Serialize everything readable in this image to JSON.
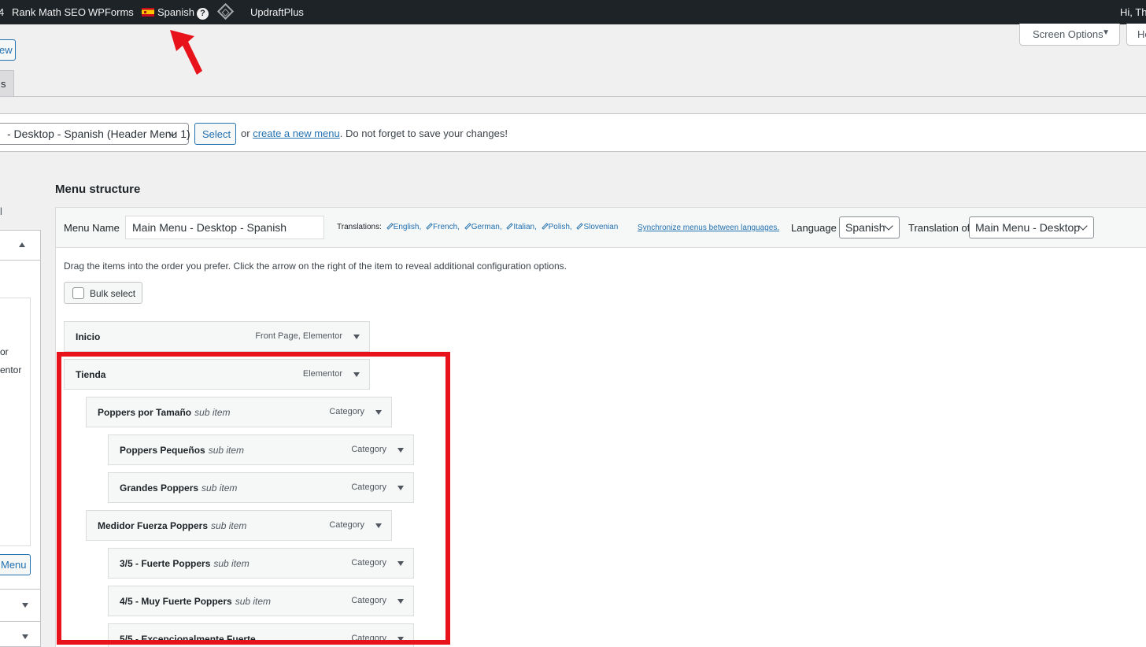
{
  "adminbar": {
    "partial_icon": "4",
    "rank_math": "Rank Math SEO",
    "wpforms": "WPForms",
    "language": "Spanish",
    "help_mark": "?",
    "updraft": "UpdraftPlus",
    "greeting": "Hi, Th"
  },
  "top": {
    "screen_options": "Screen Options",
    "help": "He",
    "new_button": "ew",
    "tab_partial": "s"
  },
  "select_bar": {
    "menu_select_value": "- Desktop - Spanish (Header Menu 1)",
    "select_button": "Select",
    "or_text": "or",
    "create_link": "create a new menu",
    "tail_text": ". Do not forget to save your changes!"
  },
  "sidebar": {
    "bar_text": "l",
    "text1": "or",
    "text2": "entor",
    "menu_button": "Menu"
  },
  "menu_structure": {
    "title": "Menu structure",
    "menu_name_label": "Menu Name",
    "menu_name_value": "Main Menu - Desktop - Spanish",
    "translations_label": "Translations:",
    "translations": [
      "English,",
      "French,",
      "German,",
      "Italian,",
      "Polish,",
      "Slovenian"
    ],
    "sync_link": "Synchronize menus between languages.",
    "language_label": "Language",
    "language_value": "Spanish",
    "translation_of_label": "Translation of",
    "translation_of_value": "Main Menu - Desktop",
    "instructions": "Drag the items into the order you prefer. Click the arrow on the right of the item to reveal additional configuration options.",
    "bulk_select": "Bulk select"
  },
  "items": [
    {
      "title": "Inicio",
      "sub": "",
      "kind": "Front Page, Elementor"
    },
    {
      "title": "Tienda",
      "sub": "",
      "kind": "Elementor"
    },
    {
      "title": "Poppers por Tamaño",
      "sub": "sub item",
      "kind": "Category"
    },
    {
      "title": "Poppers Pequeños",
      "sub": "sub item",
      "kind": "Category"
    },
    {
      "title": "Grandes Poppers",
      "sub": "sub item",
      "kind": "Category"
    },
    {
      "title": "Medidor Fuerza Poppers",
      "sub": "sub item",
      "kind": "Category"
    },
    {
      "title": "3/5 - Fuerte Poppers",
      "sub": "sub item",
      "kind": "Category"
    },
    {
      "title": "4/5 - Muy Fuerte Poppers",
      "sub": "sub item",
      "kind": "Category"
    },
    {
      "title": "5/5 - Excepcionalmente Fuerte",
      "sub": "",
      "kind": "Category"
    }
  ],
  "colors": {
    "admin_bar": "#1d2327",
    "link": "#2271b1",
    "highlight": "#e8121a"
  },
  "icons": [
    "flag-spain-icon",
    "help-icon",
    "wpml-diamond-icon",
    "pencil-icon",
    "chevron-down-icon",
    "toggle-arrow-icon",
    "checkbox-icon"
  ]
}
